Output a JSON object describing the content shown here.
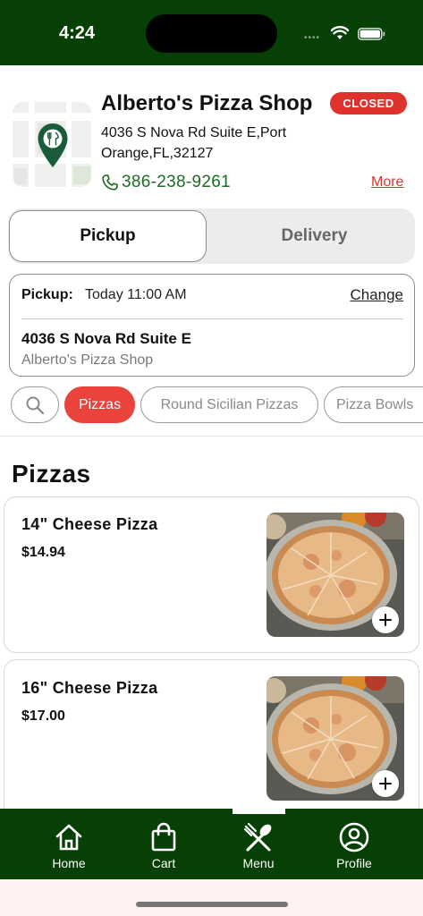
{
  "status_bar": {
    "time": "4:24",
    "dots": "••••"
  },
  "store": {
    "name": "Alberto's Pizza Shop",
    "status_badge": "CLOSED",
    "address": "4036 S Nova Rd Suite E,Port Orange,FL,32127",
    "phone": "386-238-9261",
    "more_label": "More"
  },
  "mode_toggle": {
    "pickup_label": "Pickup",
    "delivery_label": "Delivery",
    "selected": "Pickup"
  },
  "pickup_card": {
    "label": "Pickup:",
    "time": "Today 11:00 AM",
    "change_label": "Change",
    "address": "4036 S Nova Rd Suite E",
    "store_name": "Alberto's Pizza Shop"
  },
  "categories": {
    "items": [
      "Pizzas",
      "Round Sicilian Pizzas",
      "Pizza Bowls"
    ],
    "selected": "Pizzas"
  },
  "section": {
    "title": "Pizzas"
  },
  "products": [
    {
      "name": "14\" Cheese Pizza",
      "price": "$14.94"
    },
    {
      "name": "16\" Cheese Pizza",
      "price": "$17.00"
    }
  ],
  "bottom_nav": {
    "items": [
      {
        "label": "Home",
        "icon": "home-icon"
      },
      {
        "label": "Cart",
        "icon": "shopping-bag-icon"
      },
      {
        "label": "Menu",
        "icon": "utensils-icon"
      },
      {
        "label": "Profile",
        "icon": "user-circle-icon"
      }
    ],
    "selected": "Menu"
  },
  "colors": {
    "brand_green": "#064004",
    "accent_red": "#e9433b",
    "badge_red": "#e0322c",
    "phone_green": "#1f6b22"
  }
}
